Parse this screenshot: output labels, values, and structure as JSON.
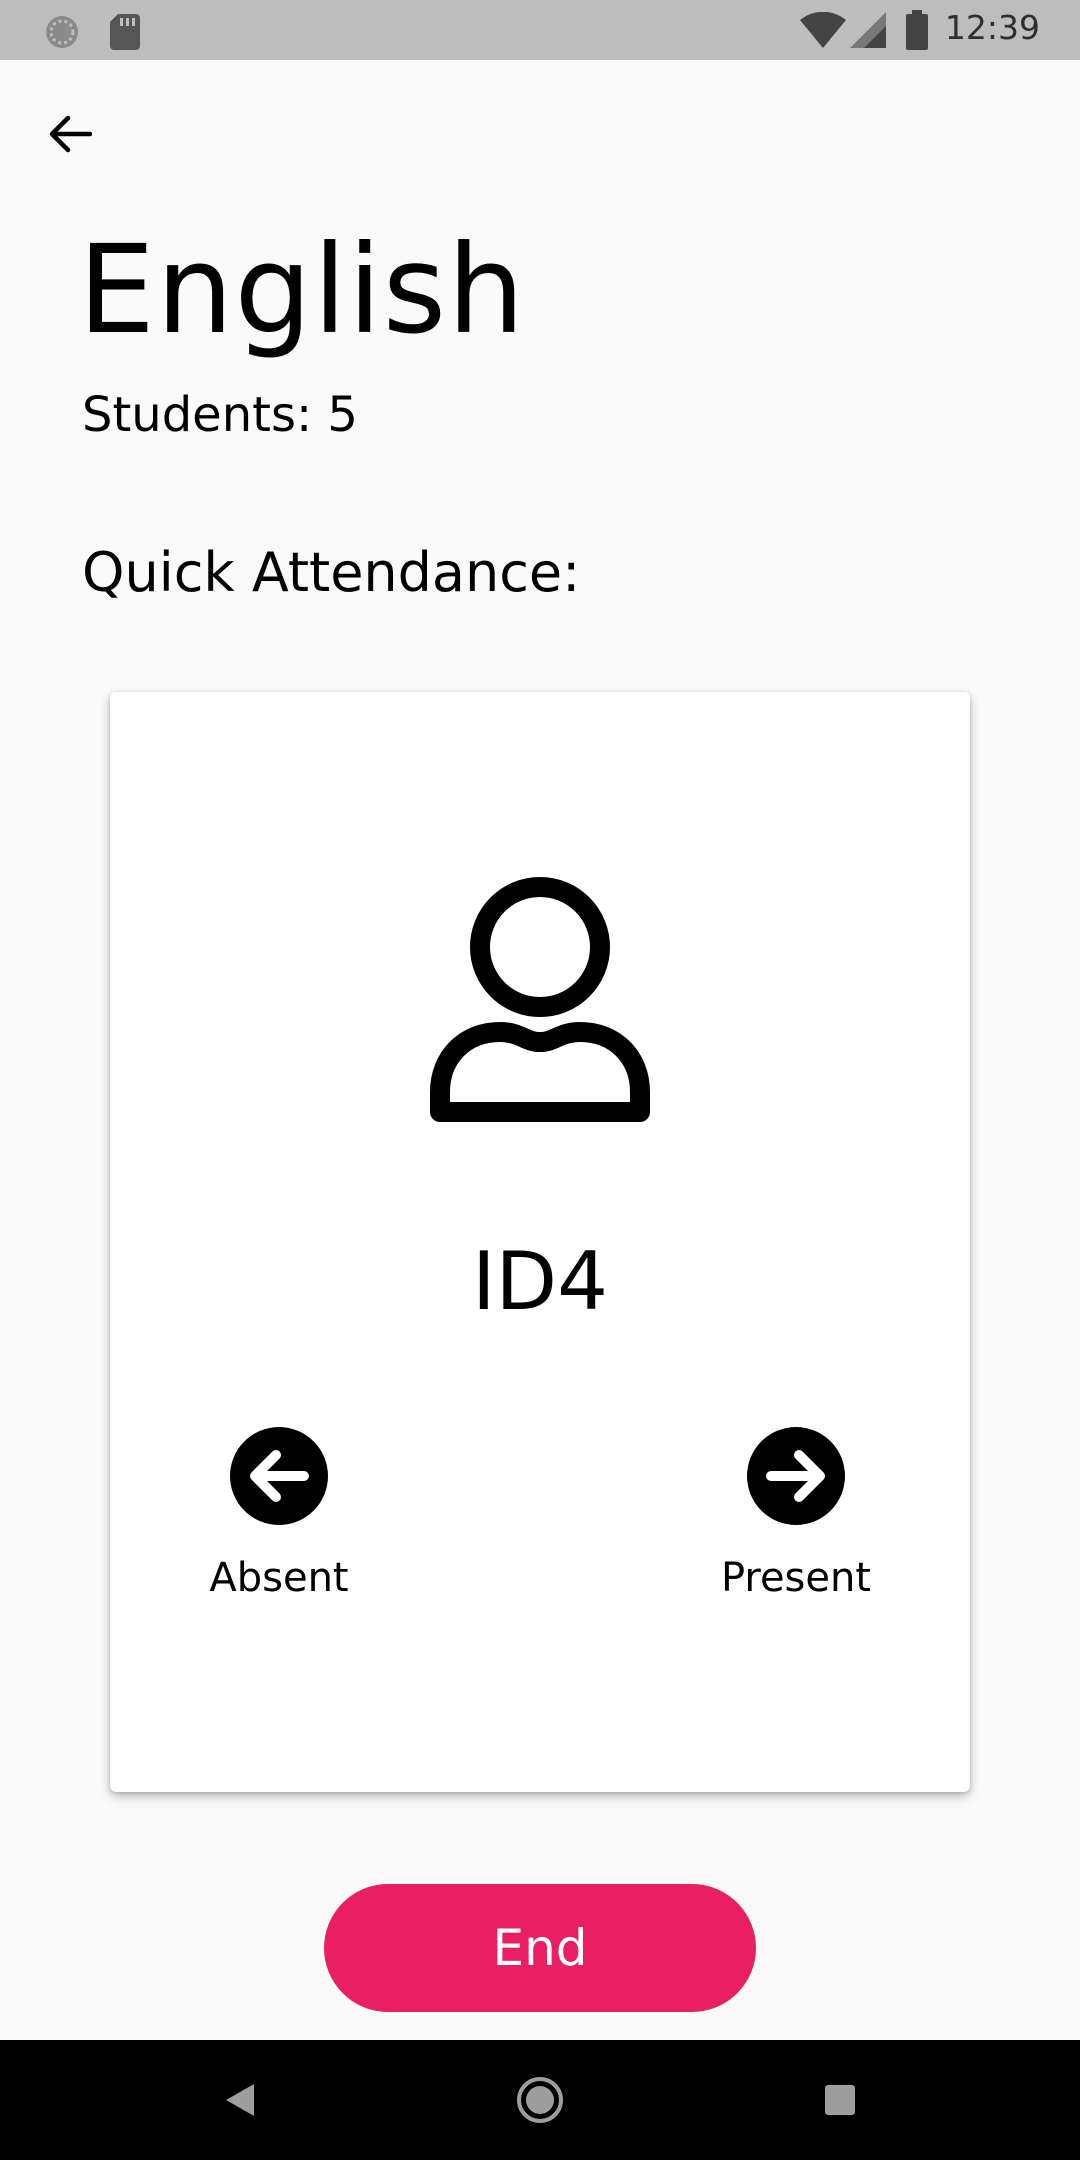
{
  "status_bar": {
    "time": "12:39",
    "icons": [
      "sync-icon",
      "sd-card-icon",
      "wifi-icon",
      "signal-icon",
      "battery-icon"
    ]
  },
  "app_bar": {
    "back_icon": "arrow-back-icon"
  },
  "header": {
    "title": "English",
    "students": "Students: 5",
    "section_label": "Quick Attendance:"
  },
  "card": {
    "avatar_icon": "person-icon",
    "student_id": "ID4",
    "absent_label": "Absent",
    "present_label": "Present"
  },
  "actions": {
    "end_label": "End"
  },
  "colors": {
    "accent": "#e91e63",
    "background": "#fafafa",
    "card": "#ffffff",
    "status_bar": "#bdbdbd",
    "nav_bar": "#000000"
  },
  "nav_bar": {
    "icons": [
      "back-triangle-icon",
      "home-circle-icon",
      "recents-square-icon"
    ]
  }
}
